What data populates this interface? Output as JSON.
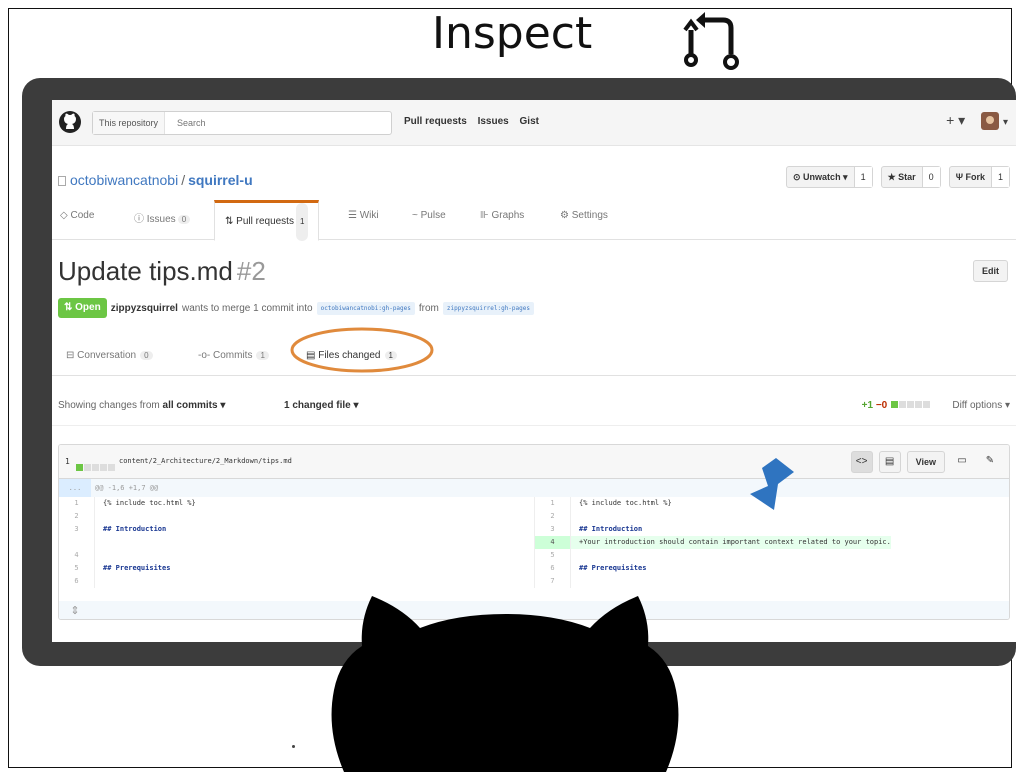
{
  "slide": {
    "title": "Inspect"
  },
  "header": {
    "search_scope": "This repository",
    "search_placeholder": "Search",
    "nav": [
      "Pull requests",
      "Issues",
      "Gist"
    ],
    "plus_label": "+ ▾",
    "avatar_menu": "▾"
  },
  "repo": {
    "owner": "octobiwancatnobi",
    "separator": "/",
    "name": "squirrel-u",
    "unwatch_label": "⊙ Unwatch ▾",
    "unwatch_count": "1",
    "star_label": "★ Star",
    "star_count": "0",
    "fork_label": "Ψ Fork",
    "fork_count": "1",
    "tabs": [
      {
        "label": "◇ Code"
      },
      {
        "label": "ⓘ Issues",
        "count": "0"
      },
      {
        "label": "⇅ Pull requests",
        "count": "1"
      },
      {
        "label": "☰ Wiki"
      },
      {
        "label": "~ Pulse"
      },
      {
        "label": "⊪ Graphs"
      },
      {
        "label": "⚙ Settings"
      }
    ]
  },
  "pr": {
    "title": "Update tips.md",
    "number": "#2",
    "edit_label": "Edit",
    "state": "⇅ Open",
    "author": "zippyzsquirrel",
    "merge_text": "wants to merge 1 commit into",
    "base_branch": "octobiwancatnobi:gh-pages",
    "from_text": "from",
    "head_branch": "zippyzsquirrel:gh-pages",
    "tabs": [
      {
        "label": "⊟ Conversation",
        "count": "0"
      },
      {
        "label": "-o- Commits",
        "count": "1"
      },
      {
        "label": "▤ Files changed",
        "count": "1"
      }
    ]
  },
  "diff_toolbar": {
    "showing_prefix": "Showing changes from",
    "showing_value": "all commits ▾",
    "changed_files": "1 changed file ▾",
    "additions": "+1",
    "deletions": "−0",
    "diff_options": "Diff options ▾"
  },
  "file": {
    "count": "1",
    "path": "content/2_Architecture/2_Markdown/tips.md",
    "view_label": "View",
    "hunk_dots": "...",
    "hunk_range": "@@ -1,6 +1,7 @@",
    "rows": [
      {
        "l_num": "1",
        "l_code": "{% include toc.html %}",
        "r_num": "1",
        "r_code": "{% include toc.html %}",
        "heading": false,
        "added": false
      },
      {
        "l_num": "2",
        "l_code": "",
        "r_num": "2",
        "r_code": "",
        "heading": false,
        "added": false
      },
      {
        "l_num": "3",
        "l_code": "## Introduction",
        "r_num": "3",
        "r_code": "## Introduction",
        "heading": true,
        "added": false
      },
      {
        "l_num": "",
        "l_code": "",
        "r_num": "4",
        "r_code": "+Your introduction should contain important context related to your topic.",
        "heading": false,
        "added": true
      },
      {
        "l_num": "4",
        "l_code": "",
        "r_num": "5",
        "r_code": "",
        "heading": false,
        "added": false
      },
      {
        "l_num": "5",
        "l_code": "## Prerequisites",
        "r_num": "6",
        "r_code": "## Prerequisites",
        "heading": true,
        "added": false
      },
      {
        "l_num": "6",
        "l_code": "",
        "r_num": "7",
        "r_code": "",
        "heading": false,
        "added": false
      }
    ]
  },
  "colors": {
    "accent_tab": "#d26911",
    "open_badge": "#6cc644",
    "link": "#4078c0",
    "highlight_circle": "#e08a3c",
    "arrow": "#2f74c0",
    "monitor": "#3c3c3c"
  }
}
